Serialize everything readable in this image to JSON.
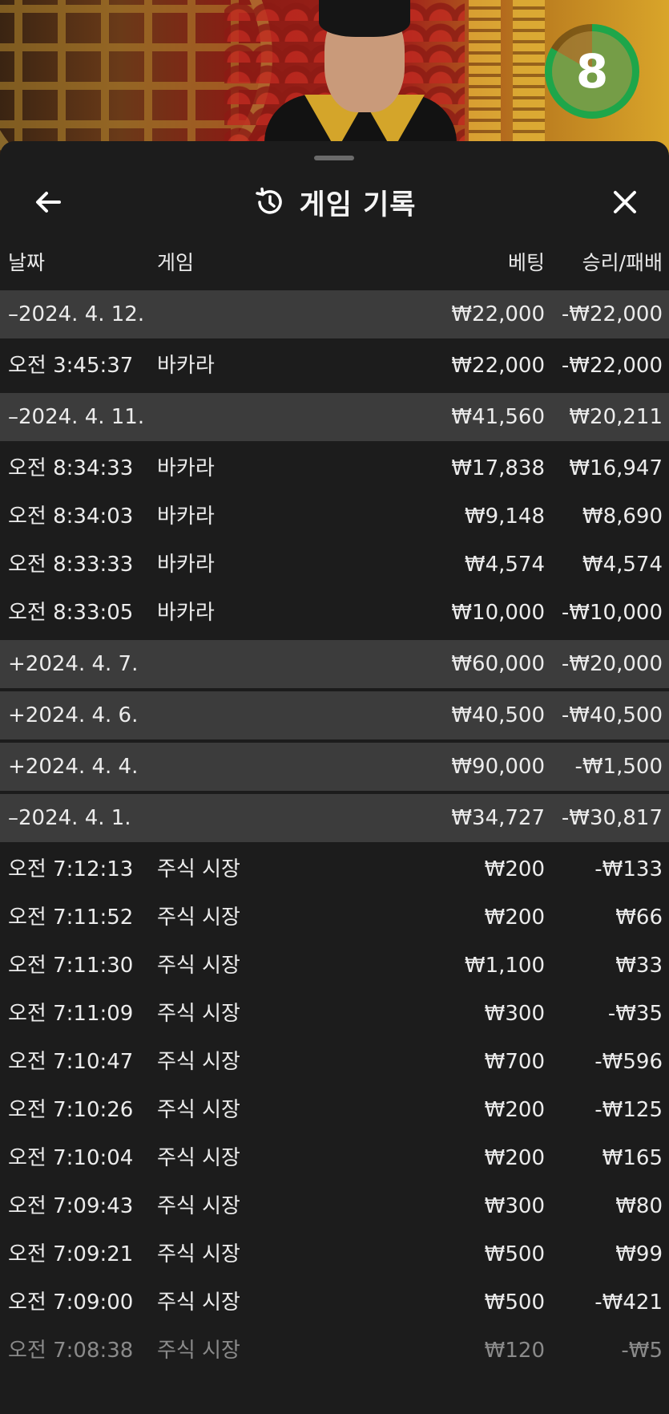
{
  "timer": {
    "count": "8"
  },
  "header": {
    "title": "게임 기록"
  },
  "columns": {
    "date": "날짜",
    "game": "게임",
    "bet": "베팅",
    "result": "승리/패배"
  },
  "rows": [
    {
      "kind": "day",
      "date": "–2024. 4. 12.",
      "game": "",
      "bet": "₩22,000",
      "result": "-₩22,000"
    },
    {
      "kind": "detail",
      "date": "오전 3:45:37",
      "game": "바카라",
      "bet": "₩22,000",
      "result": "-₩22,000"
    },
    {
      "kind": "day",
      "date": "–2024. 4. 11.",
      "game": "",
      "bet": "₩41,560",
      "result": "₩20,211"
    },
    {
      "kind": "detail",
      "date": "오전 8:34:33",
      "game": "바카라",
      "bet": "₩17,838",
      "result": "₩16,947"
    },
    {
      "kind": "detail",
      "date": "오전 8:34:03",
      "game": "바카라",
      "bet": "₩9,148",
      "result": "₩8,690"
    },
    {
      "kind": "detail",
      "date": "오전 8:33:33",
      "game": "바카라",
      "bet": "₩4,574",
      "result": "₩4,574"
    },
    {
      "kind": "detail",
      "date": "오전 8:33:05",
      "game": "바카라",
      "bet": "₩10,000",
      "result": "-₩10,000"
    },
    {
      "kind": "day",
      "date": "+2024. 4. 7.",
      "game": "",
      "bet": "₩60,000",
      "result": "-₩20,000"
    },
    {
      "kind": "day",
      "date": "+2024. 4. 6.",
      "game": "",
      "bet": "₩40,500",
      "result": "-₩40,500"
    },
    {
      "kind": "day",
      "date": "+2024. 4. 4.",
      "game": "",
      "bet": "₩90,000",
      "result": "-₩1,500"
    },
    {
      "kind": "day",
      "date": "–2024. 4. 1.",
      "game": "",
      "bet": "₩34,727",
      "result": "-₩30,817"
    },
    {
      "kind": "detail",
      "date": "오전 7:12:13",
      "game": "주식 시장",
      "bet": "₩200",
      "result": "-₩133"
    },
    {
      "kind": "detail",
      "date": "오전 7:11:52",
      "game": "주식 시장",
      "bet": "₩200",
      "result": "₩66"
    },
    {
      "kind": "detail",
      "date": "오전 7:11:30",
      "game": "주식 시장",
      "bet": "₩1,100",
      "result": "₩33"
    },
    {
      "kind": "detail",
      "date": "오전 7:11:09",
      "game": "주식 시장",
      "bet": "₩300",
      "result": "-₩35"
    },
    {
      "kind": "detail",
      "date": "오전 7:10:47",
      "game": "주식 시장",
      "bet": "₩700",
      "result": "-₩596"
    },
    {
      "kind": "detail",
      "date": "오전 7:10:26",
      "game": "주식 시장",
      "bet": "₩200",
      "result": "-₩125"
    },
    {
      "kind": "detail",
      "date": "오전 7:10:04",
      "game": "주식 시장",
      "bet": "₩200",
      "result": "₩165"
    },
    {
      "kind": "detail",
      "date": "오전 7:09:43",
      "game": "주식 시장",
      "bet": "₩300",
      "result": "₩80"
    },
    {
      "kind": "detail",
      "date": "오전 7:09:21",
      "game": "주식 시장",
      "bet": "₩500",
      "result": "₩99"
    },
    {
      "kind": "detail",
      "date": "오전 7:09:00",
      "game": "주식 시장",
      "bet": "₩500",
      "result": "-₩421"
    },
    {
      "kind": "detail",
      "date": "오전 7:08:38",
      "game": "주식 시장",
      "bet": "₩120",
      "result": "-₩5",
      "dim": true
    }
  ]
}
